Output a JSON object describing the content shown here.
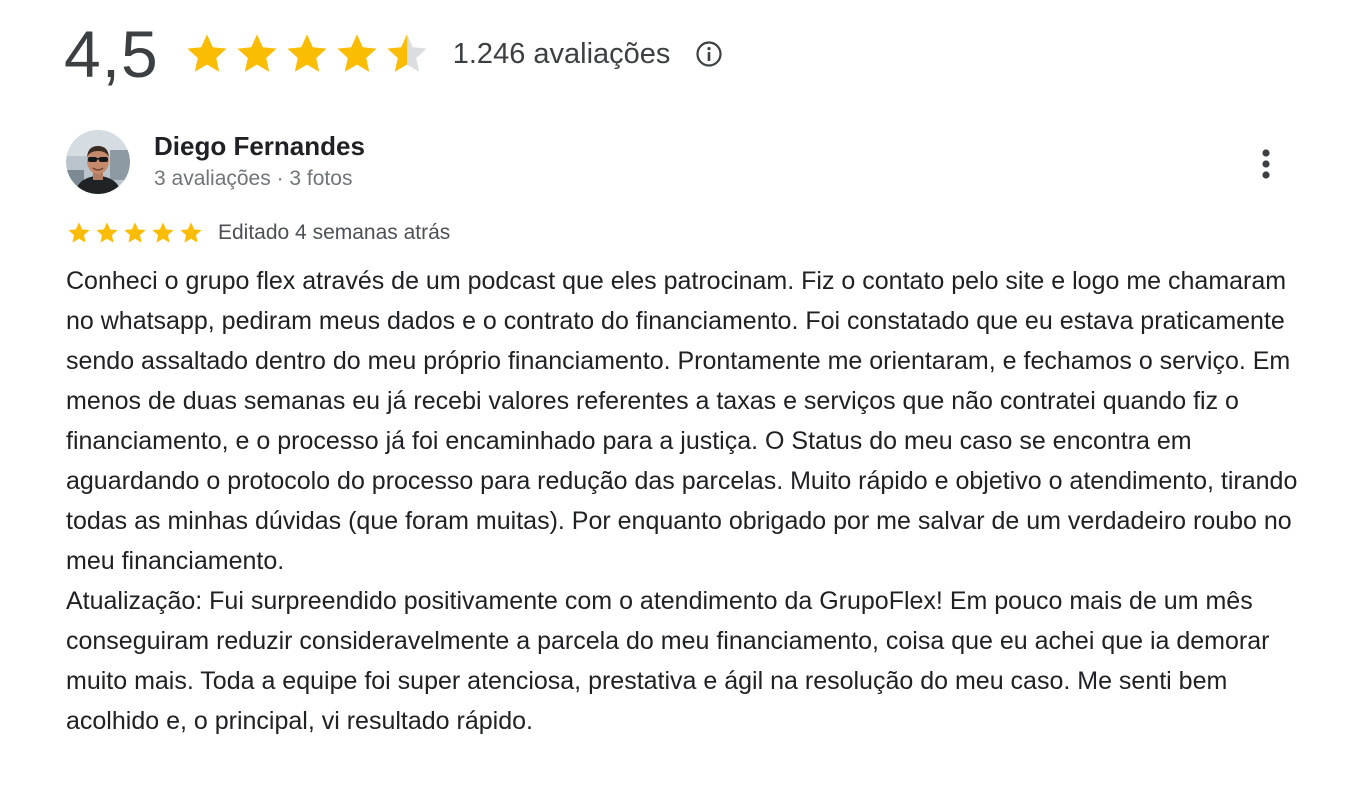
{
  "summary": {
    "average": "4,5",
    "rating_value": 4.5,
    "max_rating": 5,
    "review_count": "1.246 avaliações",
    "star_color": "#fbbc04",
    "empty_star_color": "#dadce0",
    "info_icon": "info-circle-icon"
  },
  "review": {
    "author": "Diego Fernandes",
    "author_meta": "3 avaliações · 3 fotos",
    "rating_value": 5,
    "date": "Editado 4 semanas atrás",
    "more_icon": "more-vertical-icon",
    "text": "Conheci o grupo flex através de um podcast que eles patrocinam. Fiz o contato pelo site e logo me chamaram no whatsapp, pediram meus dados e o contrato do financiamento. Foi constatado que eu estava praticamente sendo assaltado dentro do meu próprio financiamento. Prontamente me orientaram, e fechamos o serviço. Em menos de duas semanas eu já recebi valores referentes a taxas e serviços que não contratei quando fiz o financiamento, e o processo já foi encaminhado para a justiça. O Status do meu caso se encontra em aguardando o protocolo do processo para redução das parcelas. Muito rápido e objetivo o atendimento, tirando todas as minhas dúvidas (que foram muitas). Por enquanto obrigado por me salvar de um verdadeiro roubo no meu financiamento.\nAtualização: Fui surpreendido positivamente com o atendimento da GrupoFlex! Em pouco mais de um mês conseguiram reduzir consideravelmente a parcela do meu financiamento, coisa que eu achei que ia demorar muito mais. Toda a equipe foi super atenciosa, prestativa e ágil na resolução do meu caso. Me senti bem acolhido e, o principal, vi resultado rápido."
  }
}
